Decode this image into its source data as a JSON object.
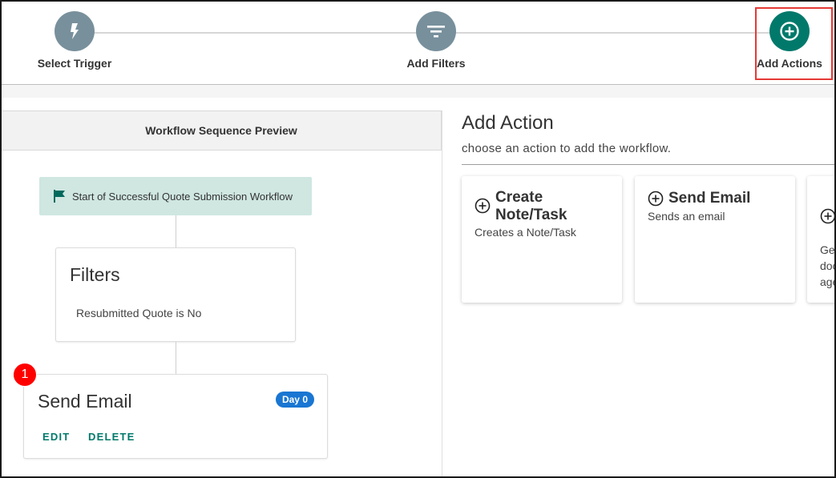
{
  "stepper": {
    "steps": [
      {
        "label": "Select Trigger",
        "icon": "lightning-icon"
      },
      {
        "label": "Add Filters",
        "icon": "filter-icon"
      },
      {
        "label": "Add Actions",
        "icon": "add-circle-icon",
        "active": true
      }
    ],
    "accent": "#00796b",
    "inactive_color": "#78909c",
    "highlight_color": "#e53935"
  },
  "preview": {
    "header": "Workflow Sequence Preview",
    "start_label": "Start of Successful Quote Submission Workflow",
    "start_icon": "flag-icon",
    "filters": {
      "title": "Filters",
      "condition": "Resubmitted Quote is No"
    },
    "email_step": {
      "number": "1",
      "title": "Send Email",
      "day_badge": "Day 0",
      "edit_label": "EDIT",
      "delete_label": "DELETE"
    }
  },
  "actions_panel": {
    "title": "Add Action",
    "subtitle": "choose an action to add the workflow.",
    "cards": [
      {
        "name": "Create Note/Task",
        "description": "Creates a Note/Task",
        "icon": "add-circle-icon"
      },
      {
        "name": "Send Email",
        "description": "Sends an email",
        "icon": "add-circle-icon"
      },
      {
        "name": "",
        "description": "Ger doc age",
        "icon": "add-circle-icon"
      }
    ],
    "partial_desc_lines": [
      "Ger",
      "doc",
      "age"
    ]
  }
}
